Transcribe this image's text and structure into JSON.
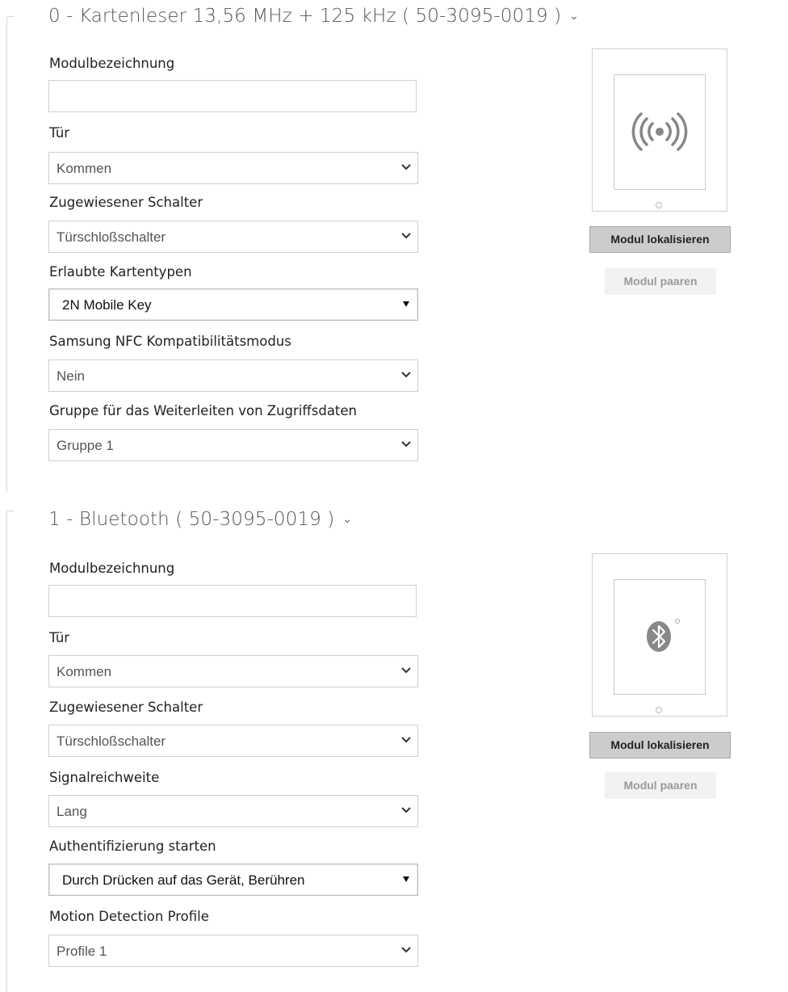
{
  "modules": [
    {
      "title": "0 - Kartenleser 13,56 MHz + 125 kHz ( 50-3095-0019 )",
      "fields": [
        {
          "label": "Modulbezeichnung",
          "value": ""
        },
        {
          "label": "Tür",
          "value": "Kommen"
        },
        {
          "label": "Zugewiesener Schalter",
          "value": "Türschloßschalter"
        },
        {
          "label": "Erlaubte Kartentypen",
          "value": "2N Mobile Key"
        },
        {
          "label": "Samsung NFC Kompatibilitätsmodus",
          "value": "Nein"
        },
        {
          "label": "Gruppe für das Weiterleiten von Zugriffsdaten",
          "value": "Gruppe 1"
        }
      ],
      "device_icon": "rfid-waves-icon",
      "locate_label": "Modul lokalisieren",
      "pair_label": "Modul paaren"
    },
    {
      "title": "1 - Bluetooth ( 50-3095-0019 )",
      "fields": [
        {
          "label": "Modulbezeichnung",
          "value": ""
        },
        {
          "label": "Tür",
          "value": "Kommen"
        },
        {
          "label": "Zugewiesener Schalter",
          "value": "Türschloßschalter"
        },
        {
          "label": "Signalreichweite",
          "value": "Lang"
        },
        {
          "label": "Authentifizierung starten",
          "value": "Durch Drücken auf das Gerät, Berühren"
        },
        {
          "label": "Motion Detection Profile",
          "value": "Profile 1"
        }
      ],
      "device_icon": "bluetooth-icon",
      "locate_label": "Modul lokalisieren",
      "pair_label": "Modul paaren"
    }
  ],
  "colors": {
    "section_title": "#555555",
    "button_locate": "#cccccc",
    "button_pair": "#f2f2f2",
    "icon": "#888888"
  }
}
